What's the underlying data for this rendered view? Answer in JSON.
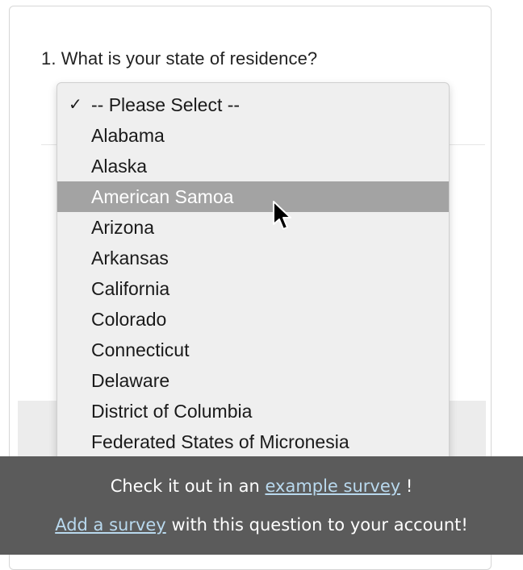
{
  "question": {
    "number": "1.",
    "text": "What is your state of residence?"
  },
  "dropdown": {
    "selected_marker": "✓",
    "options": [
      "-- Please Select --",
      "Alabama",
      "Alaska",
      "American Samoa",
      "Arizona",
      "Arkansas",
      "California",
      "Colorado",
      "Connecticut",
      "Delaware",
      "District of Columbia",
      "Federated States of Micronesia"
    ],
    "checked_option": "-- Please Select --",
    "highlighted_option": "American Samoa"
  },
  "banner": {
    "line1_prefix": "Check it out in an",
    "line1_link": "example survey",
    "line1_suffix": "!",
    "line2_link": "Add a survey",
    "line2_suffix": "with this question to your account!"
  },
  "colors": {
    "highlight": "#a3a3a3",
    "banner_bg": "#5b5b5b",
    "link": "#b9d9ee"
  }
}
